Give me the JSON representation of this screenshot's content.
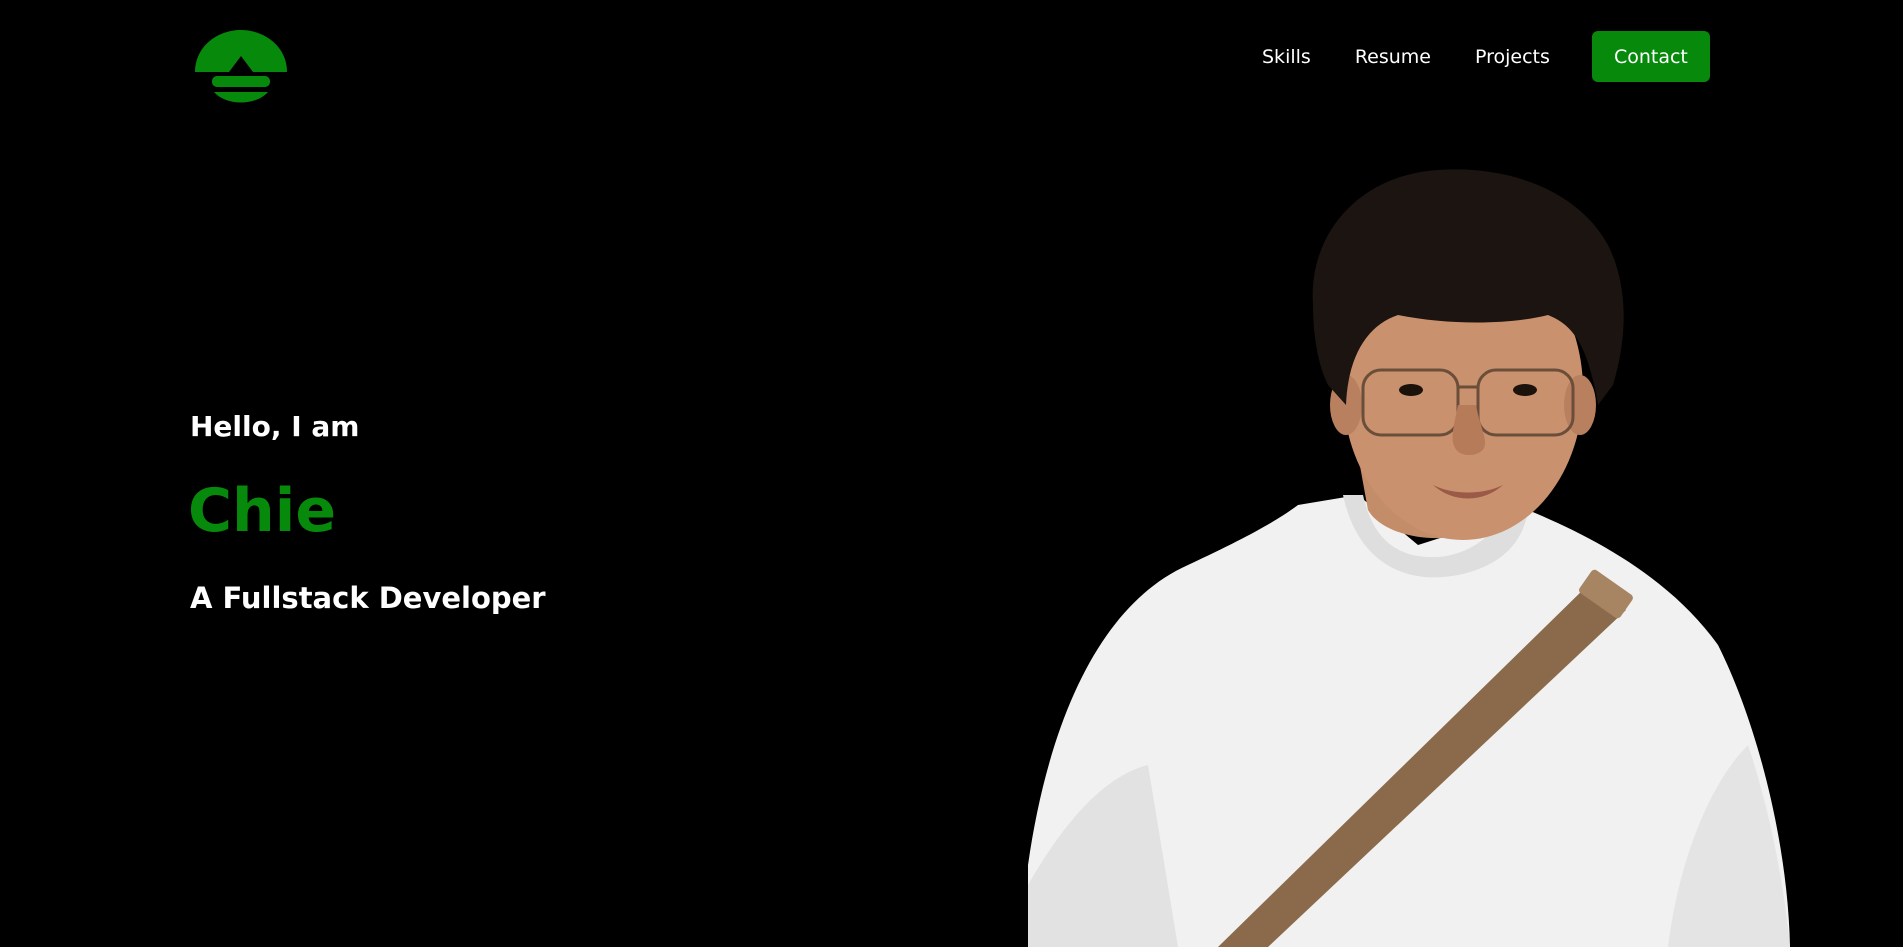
{
  "logo": {
    "name": "logo-mark",
    "color": "#078a0c"
  },
  "nav": {
    "items": [
      {
        "label": "Skills"
      },
      {
        "label": "Resume"
      },
      {
        "label": "Projects"
      }
    ],
    "contact_label": "Contact",
    "accent": "#078a0c"
  },
  "hero": {
    "greeting": "Hello, I am",
    "name": "Chie",
    "role": "A Fullstack Developer"
  },
  "portrait": {
    "alt": "Portrait photo"
  },
  "colors": {
    "background": "#000000",
    "text": "#ffffff",
    "accent": "#078a0c"
  }
}
